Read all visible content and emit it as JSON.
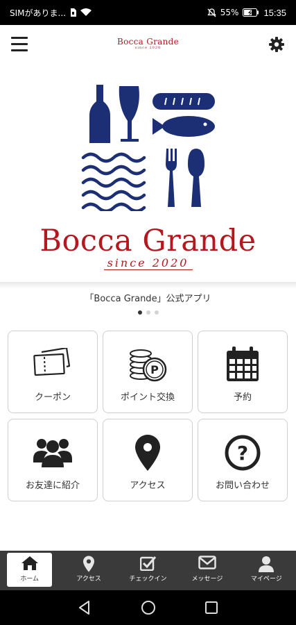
{
  "status_bar": {
    "carrier": "SIMがありま...",
    "battery": "55%",
    "time": "15:35"
  },
  "header": {
    "logo_title": "Bocca Grande",
    "logo_subtitle": "since 2020",
    "menu_icon": "hamburger-icon",
    "settings_icon": "gear-icon"
  },
  "hero": {
    "brand": "Bocca Grande",
    "since": "since 2020",
    "illustration_color": "#1c2f75",
    "brand_color": "#b4181f"
  },
  "carousel": {
    "caption": "「Bocca Grande」公式アプリ",
    "page_count": 3,
    "active_page": 1
  },
  "menu": [
    {
      "label": "クーポン",
      "icon": "ticket-icon"
    },
    {
      "label": "ポイント交換",
      "icon": "coins-icon"
    },
    {
      "label": "予約",
      "icon": "calendar-icon"
    },
    {
      "label": "お友達に紹介",
      "icon": "users-icon"
    },
    {
      "label": "アクセス",
      "icon": "map-pin-icon"
    },
    {
      "label": "お問い合わせ",
      "icon": "question-icon"
    }
  ],
  "tabbar": {
    "tabs": [
      {
        "label": "ホーム",
        "icon": "home-icon",
        "active": true
      },
      {
        "label": "アクセス",
        "icon": "map-pin-icon",
        "active": false
      },
      {
        "label": "チェックイン",
        "icon": "checkbox-icon",
        "active": false
      },
      {
        "label": "メッセージ",
        "icon": "mail-icon",
        "active": false
      },
      {
        "label": "マイページ",
        "icon": "user-icon",
        "active": false
      }
    ],
    "bg_color": "#3a3a3a"
  },
  "system_nav": {
    "back_icon": "back-triangle-icon",
    "home_icon": "home-circle-icon",
    "recents_icon": "recents-square-icon"
  }
}
